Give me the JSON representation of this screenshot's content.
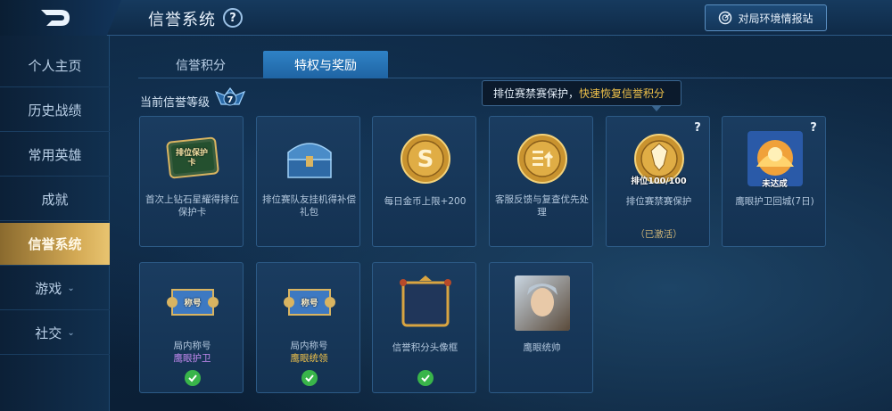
{
  "header": {
    "title": "信誉系统",
    "help": "?",
    "intel_button": "对局环境情报站"
  },
  "sidebar": {
    "items": [
      {
        "label": "个人主页",
        "caret": ""
      },
      {
        "label": "历史战绩",
        "caret": ""
      },
      {
        "label": "常用英雄",
        "caret": ""
      },
      {
        "label": "成就",
        "caret": ""
      },
      {
        "label": "信誉系统",
        "caret": "",
        "active": true
      },
      {
        "label": "游戏",
        "caret": "⌄"
      },
      {
        "label": "社交",
        "caret": "⌄"
      }
    ]
  },
  "tabs": [
    {
      "label": "信誉积分",
      "active": false
    },
    {
      "label": "特权与奖励",
      "active": true
    }
  ],
  "level": {
    "label": "当前信誉等级",
    "value": "7"
  },
  "tooltip": {
    "text_plain": "排位赛禁赛保护，",
    "text_highlight": "快速恢复信誉积分"
  },
  "cards": [
    {
      "title": "首次上钻石星耀得排位保护卡",
      "icon": "protect-card-icon",
      "art_text": "排位保护卡"
    },
    {
      "title": "排位赛队友挂机得补偿礼包",
      "icon": "treasure-chest-icon"
    },
    {
      "title": "每日金币上限+200",
      "icon": "gold-coin-icon",
      "art_text": "S"
    },
    {
      "title": "客服反馈与复查优先处理",
      "icon": "priority-coin-icon"
    },
    {
      "title": "排位赛禁赛保护",
      "icon": "rank-shield-icon",
      "art_text": "排位100/100",
      "status": "（已激活）",
      "help": "?"
    },
    {
      "title": "鹰眼护卫回城(7日)",
      "icon": "recall-effect-icon",
      "art_text": "未达成",
      "help": "?"
    },
    {
      "title": "局内称号",
      "subtitle": "鹰眼护卫",
      "icon": "title-scroll-icon",
      "art_text": "称号"
    },
    {
      "title": "局内称号",
      "subtitle": "鹰眼统领",
      "icon": "title-scroll-icon",
      "art_text": "称号"
    },
    {
      "title": "信誉积分头像框",
      "icon": "avatar-frame-icon"
    },
    {
      "title": "鹰眼统帅",
      "icon": "hero-portrait-icon"
    }
  ],
  "colors": {
    "accent_gold": "#f0c24a",
    "active_tab": "#2f82c6",
    "purple_title": "#c48af0",
    "check_green": "#39b54a"
  }
}
